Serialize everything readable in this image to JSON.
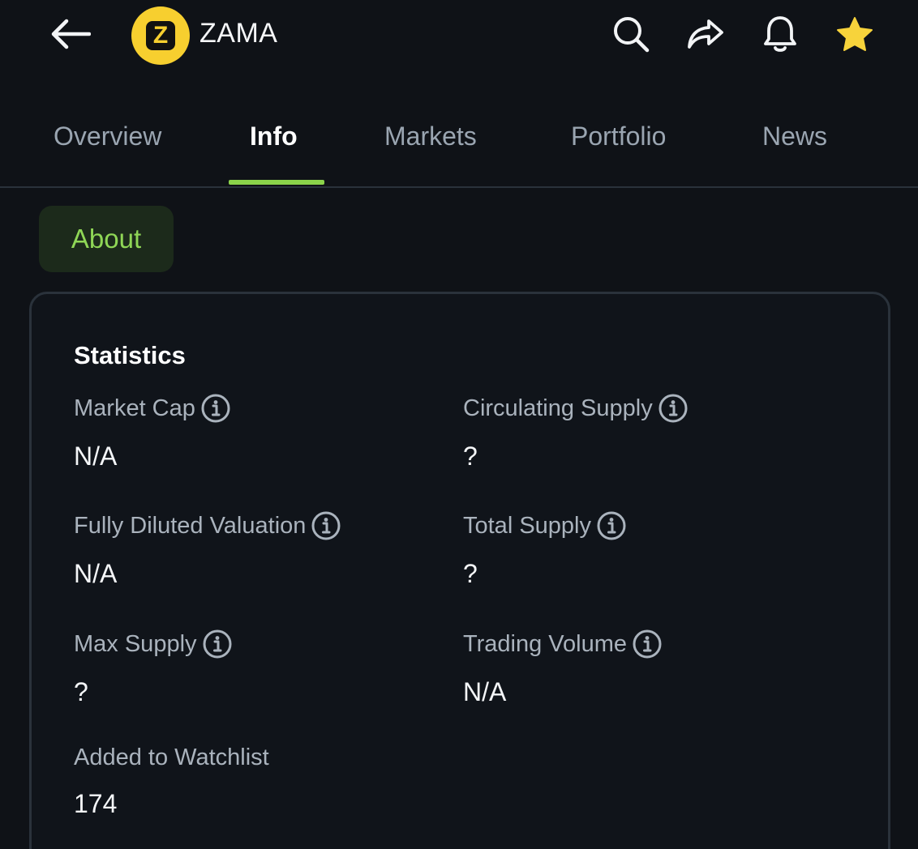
{
  "header": {
    "token_name": "ZAMA",
    "logo_letter": "Z",
    "logo_color": "#f7cf2f",
    "icons": [
      "back-arrow-icon",
      "search-icon",
      "share-icon",
      "bell-icon",
      "star-icon"
    ]
  },
  "tabs": [
    {
      "label": "Overview"
    },
    {
      "label": "Info",
      "active": true
    },
    {
      "label": "Markets"
    },
    {
      "label": "Portfolio"
    },
    {
      "label": "News"
    }
  ],
  "accent_color": "#8bd34a",
  "star_color": "#f7d33b",
  "about_chip": {
    "label": "About"
  },
  "statistics": {
    "title": "Statistics",
    "items": [
      {
        "label": "Market Cap",
        "value": "N/A",
        "has_info": true
      },
      {
        "label": "Circulating Supply",
        "value": "?",
        "has_info": true
      },
      {
        "label": "Fully Diluted Valuation",
        "value": "N/A",
        "has_info": true
      },
      {
        "label": "Total Supply",
        "value": "?",
        "has_info": true
      },
      {
        "label": "Max Supply",
        "value": "?",
        "has_info": true
      },
      {
        "label": "Trading Volume",
        "value": "N/A",
        "has_info": true
      },
      {
        "label": "Added to Watchlist",
        "value": "174",
        "has_info": false
      }
    ]
  }
}
